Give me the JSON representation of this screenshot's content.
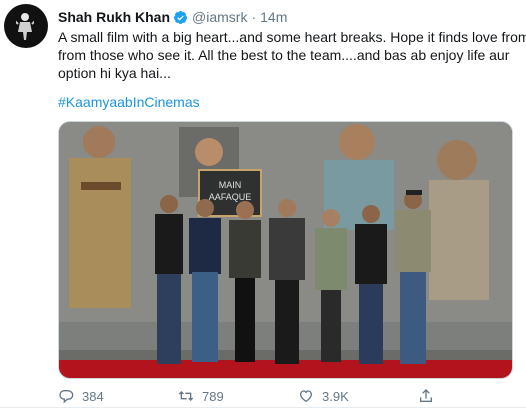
{
  "tweet": {
    "author_name": "Shah Rukh Khan",
    "author_handle": "@iamsrk",
    "separator": "·",
    "timestamp": "14m",
    "verified_icon": "verified-badge-icon",
    "text_lines": [
      "A small film with a big heart...and some heart breaks. Hope it finds love from",
      "from those who see it. All the best to the team....and bas ab enjoy life aur",
      "option hi kya hai..."
    ],
    "hashtag": "#KaamyaabInCinemas",
    "media": {
      "board_line1": "MAIN",
      "board_line2": "AAFAQUE"
    }
  },
  "actions": {
    "reply_count": "384",
    "retweet_count": "789",
    "like_count": "3.9K",
    "icons": [
      "reply-icon",
      "retweet-icon",
      "like-icon",
      "share-icon"
    ]
  },
  "colors": {
    "link": "#1b95e0",
    "muted": "#657786",
    "verified": "#1da1f2",
    "carpet": "#b3131c"
  }
}
